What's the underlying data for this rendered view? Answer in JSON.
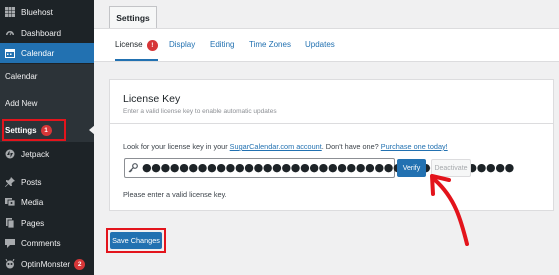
{
  "sidebar": {
    "items": [
      {
        "label": "Bluehost",
        "icon": "bluehost-icon"
      },
      {
        "label": "Dashboard",
        "icon": "dashboard-icon"
      },
      {
        "label": "Calendar",
        "icon": "calendar-icon"
      },
      {
        "label": "Posts",
        "icon": "pushpin-icon"
      },
      {
        "label": "Media",
        "icon": "media-icon"
      },
      {
        "label": "Pages",
        "icon": "pages-icon"
      },
      {
        "label": "Comments",
        "icon": "comments-icon"
      },
      {
        "label": "OptinMonster",
        "icon": "optinmonster-icon",
        "badge": "2"
      }
    ],
    "calendar_sub": [
      "Calendar",
      "Add New"
    ],
    "settings": {
      "label": "Settings",
      "badge": "1"
    },
    "jetpack": {
      "label": "Jetpack",
      "icon": "jetpack-icon"
    }
  },
  "page": {
    "tab_title": "Settings",
    "subtabs": [
      {
        "label": "License",
        "badge": "!"
      },
      {
        "label": "Display"
      },
      {
        "label": "Editing"
      },
      {
        "label": "Time Zones"
      },
      {
        "label": "Updates"
      }
    ]
  },
  "license": {
    "title": "License Key",
    "description": "Enter a valid license key to enable automatic updates",
    "lookfor_prefix": "Look for your license key in your ",
    "account_link": "SugarCalendar.com account",
    "lookfor_middle": ". Don't have one? ",
    "purchase_link": "Purchase one today!",
    "key_value": "●●●●●●●●●●●●●●●●●●●●●●●●●●●●●●●●●●●●●●●●",
    "verify_label": "Verify",
    "deactivate_label": "Deactivate",
    "status": "Please enter a valid license key."
  },
  "save_label": "Save Changes",
  "colors": {
    "accent": "#2271b1",
    "sidebar": "#1d2327",
    "highlight": "#e3141c"
  }
}
